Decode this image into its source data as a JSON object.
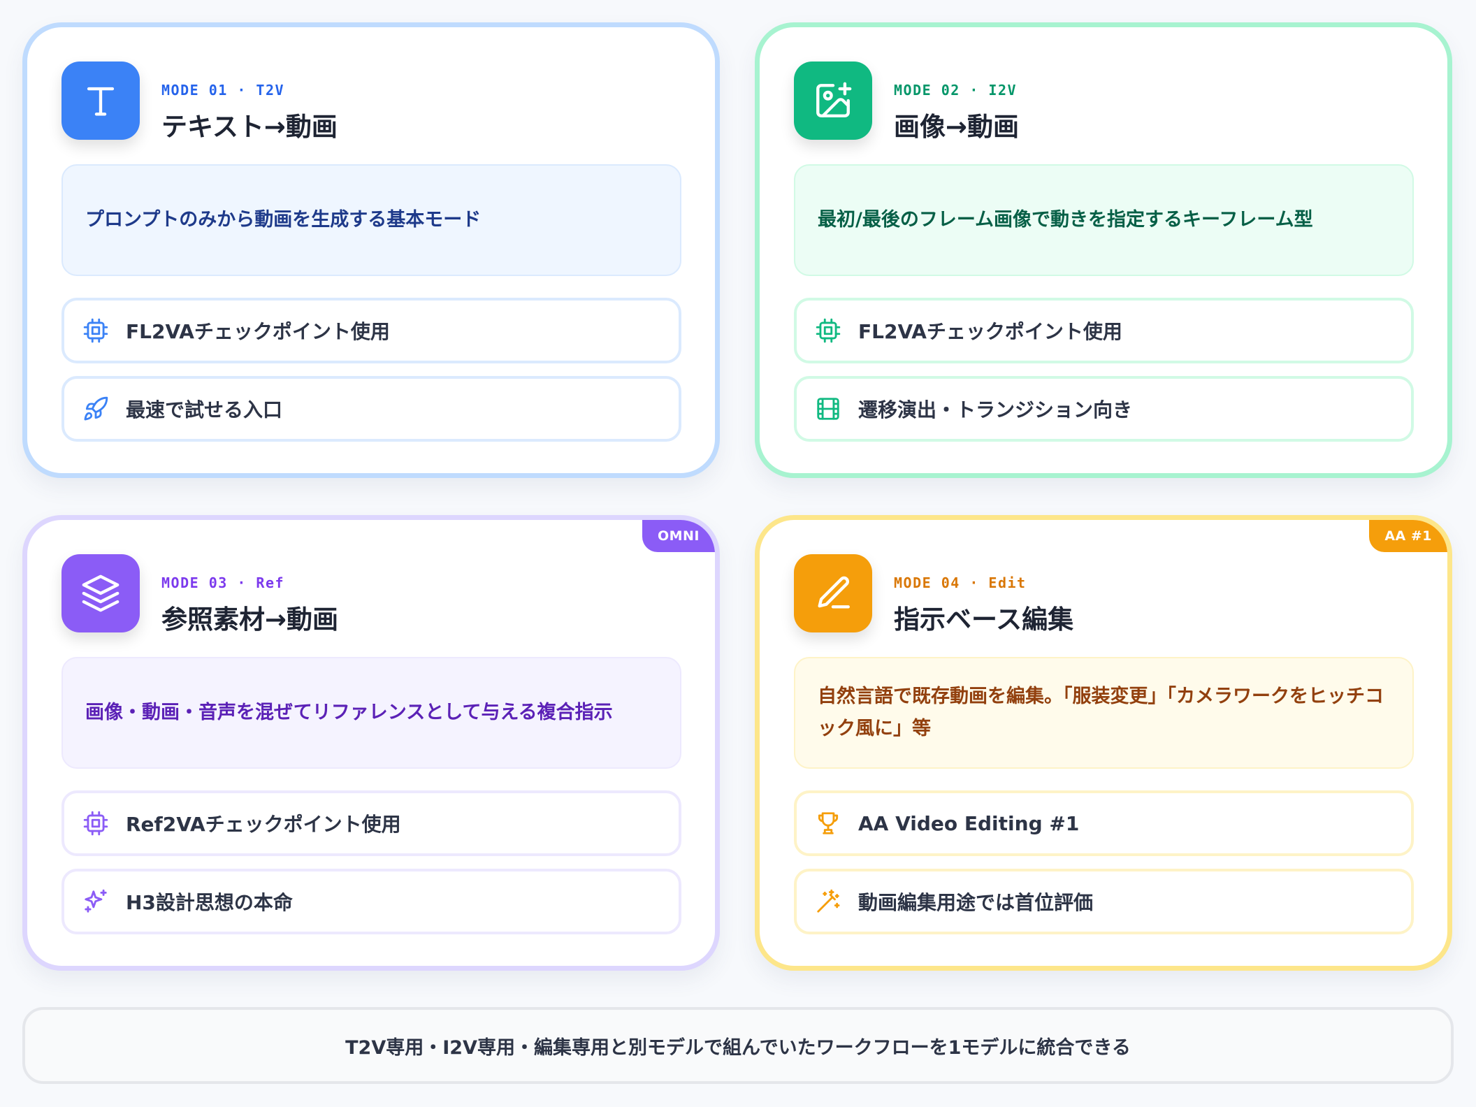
{
  "cards": {
    "t2v": {
      "mode": "MODE 01 · T2V",
      "title": "テキスト→動画",
      "description": "プロンプトのみから動画を生成する基本モード",
      "features": [
        "FL2VAチェックポイント使用",
        "最速で試せる入口"
      ],
      "icon": "text-t-icon",
      "feature_icons": [
        "chip-icon",
        "rocket-icon"
      ],
      "color": "#3b82f6"
    },
    "i2v": {
      "mode": "MODE 02 · I2V",
      "title": "画像→動画",
      "description": "最初/最後のフレーム画像で動きを指定するキーフレーム型",
      "features": [
        "FL2VAチェックポイント使用",
        "遷移演出・トランジション向き"
      ],
      "icon": "image-plus-icon",
      "feature_icons": [
        "chip-icon",
        "film-icon"
      ],
      "color": "#10b981"
    },
    "ref": {
      "mode": "MODE 03 · Ref",
      "title": "参照素材→動画",
      "description": "画像・動画・音声を混ぜてリファレンスとして与える複合指示",
      "features": [
        "Ref2VAチェックポイント使用",
        "H3設計思想の本命"
      ],
      "badge": "OMNI",
      "icon": "layers-icon",
      "feature_icons": [
        "chip-icon",
        "sparkles-icon"
      ],
      "color": "#8b5cf6"
    },
    "edit": {
      "mode": "MODE 04 · Edit",
      "title": "指示ベース編集",
      "description": "自然言語で既存動画を編集。「服装変更」「カメラワークをヒッチコック風に」等",
      "features": [
        "AA Video Editing #1",
        "動画編集用途では首位評価"
      ],
      "badge": "AA #1",
      "icon": "pen-icon",
      "feature_icons": [
        "trophy-icon",
        "magic-wand-icon"
      ],
      "color": "#f59e0b"
    }
  },
  "footer": {
    "text": "T2V専用・I2V専用・編集専用と別モデルで組んでいたワークフローを1モデルに統合できる"
  }
}
